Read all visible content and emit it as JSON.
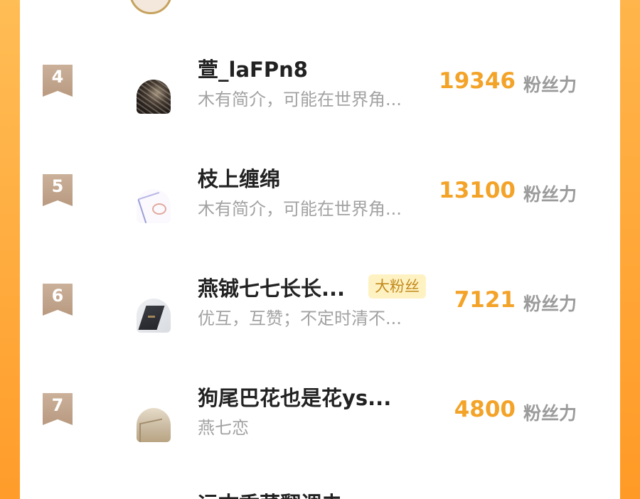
{
  "theme": {
    "accent_orange": "#ffa534",
    "score_color": "#f3a328",
    "badge_color": "#c4a68c"
  },
  "rows": [
    {
      "rank": "4",
      "name": "萱_laFPn8",
      "bio": "木有简介，可能在世界角...",
      "score": "19346",
      "unit": "粉丝力",
      "tag": ""
    },
    {
      "rank": "5",
      "name": "枝上缠绵",
      "bio": "木有简介，可能在世界角...",
      "score": "13100",
      "unit": "粉丝力",
      "tag": ""
    },
    {
      "rank": "6",
      "name": "燕铖七七长长...",
      "bio": "优互，互赞；不定时清不...",
      "score": "7121",
      "unit": "粉丝力",
      "tag": "大粉丝"
    },
    {
      "rank": "7",
      "name": "狗尾巴花也是花ys...",
      "bio": "燕七恋",
      "score": "4800",
      "unit": "粉丝力",
      "tag": ""
    }
  ],
  "partial_next_name": "运古香菜翻调夫"
}
